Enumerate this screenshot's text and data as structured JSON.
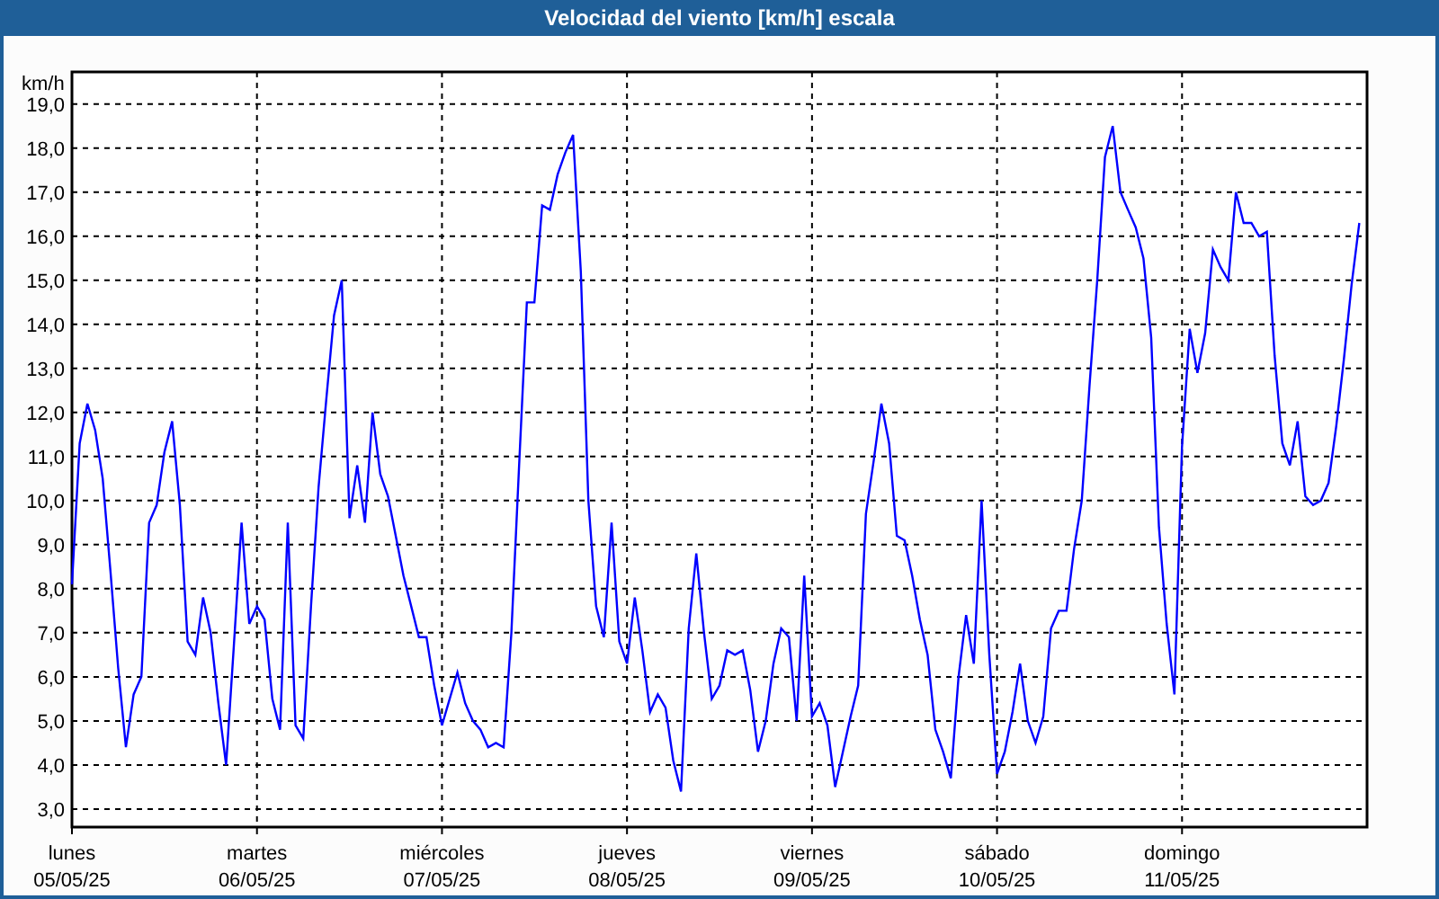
{
  "window": {
    "title": "Velocidad del viento [km/h] escala"
  },
  "chart": {
    "chart_data": {
      "type": "line",
      "grid": true,
      "ylabel": "km/h",
      "ylim": [
        2.59,
        19.73
      ],
      "yticks": [
        {
          "value": 3,
          "label": "3,0"
        },
        {
          "value": 4,
          "label": "4,0"
        },
        {
          "value": 5,
          "label": "5,0"
        },
        {
          "value": 6,
          "label": "6,0"
        },
        {
          "value": 7,
          "label": "7,0"
        },
        {
          "value": 8,
          "label": "8,0"
        },
        {
          "value": 9,
          "label": "9,0"
        },
        {
          "value": 10,
          "label": "10,0"
        },
        {
          "value": 11,
          "label": "11,0"
        },
        {
          "value": 12,
          "label": "12,0"
        },
        {
          "value": 13,
          "label": "13,0"
        },
        {
          "value": 14,
          "label": "14,0"
        },
        {
          "value": 15,
          "label": "15,0"
        },
        {
          "value": 16,
          "label": "16,0"
        },
        {
          "value": 17,
          "label": "17,0"
        },
        {
          "value": 18,
          "label": "18,0"
        },
        {
          "value": 19,
          "label": "19,0"
        }
      ],
      "categories": [
        "lunes\n05/05/25",
        null,
        null,
        null,
        null,
        null,
        null,
        null,
        null,
        null,
        null,
        null,
        null,
        null,
        null,
        null,
        null,
        null,
        null,
        null,
        null,
        null,
        null,
        null,
        "martes\n06/05/25",
        null,
        null,
        null,
        null,
        null,
        null,
        null,
        null,
        null,
        null,
        null,
        null,
        null,
        null,
        null,
        null,
        null,
        null,
        null,
        null,
        null,
        null,
        null,
        "miércoles\n07/05/25",
        null,
        null,
        null,
        null,
        null,
        null,
        null,
        null,
        null,
        null,
        null,
        null,
        null,
        null,
        null,
        null,
        null,
        null,
        null,
        null,
        null,
        null,
        null,
        "jueves\n08/05/25",
        null,
        null,
        null,
        null,
        null,
        null,
        null,
        null,
        null,
        null,
        null,
        null,
        null,
        null,
        null,
        null,
        null,
        null,
        null,
        null,
        null,
        null,
        null,
        "viernes\n09/05/25",
        null,
        null,
        null,
        null,
        null,
        null,
        null,
        null,
        null,
        null,
        null,
        null,
        null,
        null,
        null,
        null,
        null,
        null,
        null,
        null,
        null,
        null,
        null,
        "sábado\n10/05/25",
        null,
        null,
        null,
        null,
        null,
        null,
        null,
        null,
        null,
        null,
        null,
        null,
        null,
        null,
        null,
        null,
        null,
        null,
        null,
        null,
        null,
        null,
        null,
        "domingo\n11/05/25",
        null,
        null,
        null,
        null,
        null,
        null,
        null,
        null,
        null,
        null,
        null,
        null,
        null,
        null,
        null,
        null,
        null,
        null,
        null,
        null,
        null,
        null,
        null
      ],
      "series": [
        {
          "color": "#0000ff",
          "values": [
            8.1,
            11.3,
            12.2,
            11.6,
            10.5,
            8.4,
            6.2,
            4.4,
            5.6,
            6.0,
            9.5,
            9.9,
            11.1,
            11.8,
            9.9,
            6.8,
            6.5,
            7.8,
            7.0,
            5.4,
            4.0,
            6.7,
            9.5,
            7.2,
            7.6,
            7.3,
            5.5,
            4.8,
            9.5,
            4.9,
            4.6,
            7.6,
            10.3,
            12.3,
            14.2,
            15.0,
            9.6,
            10.8,
            9.5,
            12.0,
            10.6,
            10.1,
            9.2,
            8.3,
            7.6,
            6.9,
            6.9,
            5.8,
            4.9,
            5.5,
            6.1,
            5.4,
            5.0,
            4.8,
            4.4,
            4.5,
            4.4,
            7.0,
            10.8,
            14.5,
            14.5,
            16.7,
            16.6,
            17.4,
            17.9,
            18.3,
            15.2,
            10.0,
            7.6,
            6.9,
            9.5,
            6.8,
            6.3,
            7.8,
            6.6,
            5.2,
            5.6,
            5.3,
            4.1,
            3.4,
            7.1,
            8.8,
            7.0,
            5.5,
            5.8,
            6.6,
            6.5,
            6.6,
            5.7,
            4.3,
            5.0,
            6.3,
            7.1,
            6.9,
            5.0,
            8.3,
            5.1,
            5.4,
            4.9,
            3.5,
            4.3,
            5.1,
            5.8,
            9.7,
            10.9,
            12.2,
            11.3,
            9.2,
            9.1,
            8.3,
            7.3,
            6.5,
            4.8,
            4.3,
            3.7,
            6.0,
            7.4,
            6.3,
            10.0,
            6.5,
            3.8,
            4.3,
            5.2,
            6.3,
            5.0,
            4.5,
            5.1,
            7.1,
            7.5,
            7.5,
            8.9,
            10.0,
            12.6,
            15.0,
            17.8,
            18.5,
            17.0,
            16.6,
            16.2,
            15.5,
            13.7,
            9.4,
            7.2,
            5.6,
            11.2,
            13.9,
            12.9,
            13.8,
            15.7,
            15.3,
            15.0,
            17.0,
            16.3,
            16.3,
            16.0,
            16.1,
            13.3,
            11.3,
            10.8,
            11.8,
            10.1,
            9.9,
            10.0,
            10.4,
            11.7,
            13.2,
            14.9,
            16.3
          ]
        }
      ]
    }
  }
}
